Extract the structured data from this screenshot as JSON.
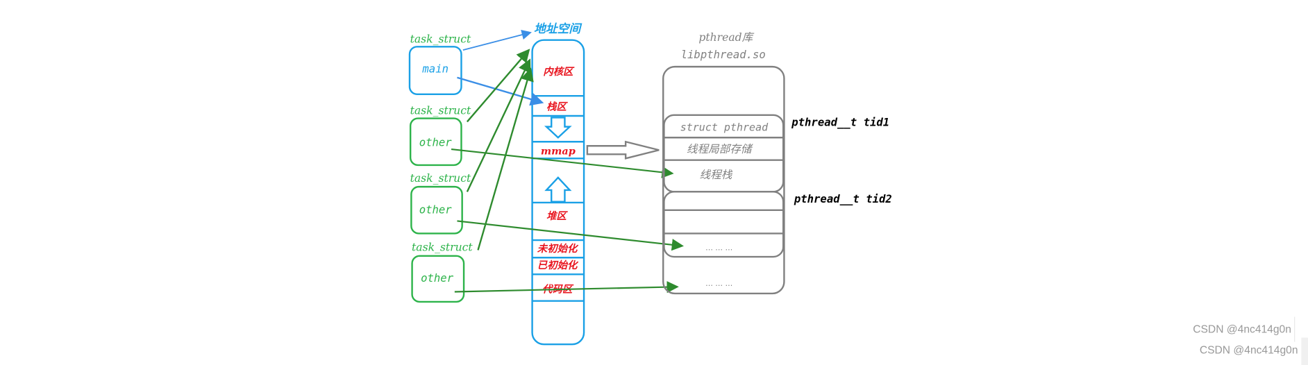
{
  "colors": {
    "blue": "#1aa0e6",
    "green": "#2db34a",
    "arrow_green": "#2e8b2e",
    "red": "#e8141e",
    "gray": "#808080"
  },
  "address_space": {
    "title": "地址空间",
    "regions": [
      "内核区",
      "栈区",
      "mmap",
      "堆区",
      "未初始化",
      "已初始化",
      "代码区"
    ]
  },
  "tasks": [
    {
      "label": "task_struct",
      "name": "main"
    },
    {
      "label": "task_struct",
      "name": "other"
    },
    {
      "label": "task_struct",
      "name": "other"
    },
    {
      "label": "task_struct",
      "name": "other"
    }
  ],
  "library": {
    "title": "pthread库",
    "subtitle": "libpthread.so",
    "struct": "struct pthread",
    "tls": "线程局部存储",
    "stack": "线程栈",
    "ellipsis1": "… … …",
    "ellipsis2": "… … …"
  },
  "tids": [
    "pthread__t tid1",
    "pthread__t tid2"
  ],
  "watermarks": [
    "CSDN @4nc414g0n",
    "CSDN @4nc414g0n"
  ]
}
